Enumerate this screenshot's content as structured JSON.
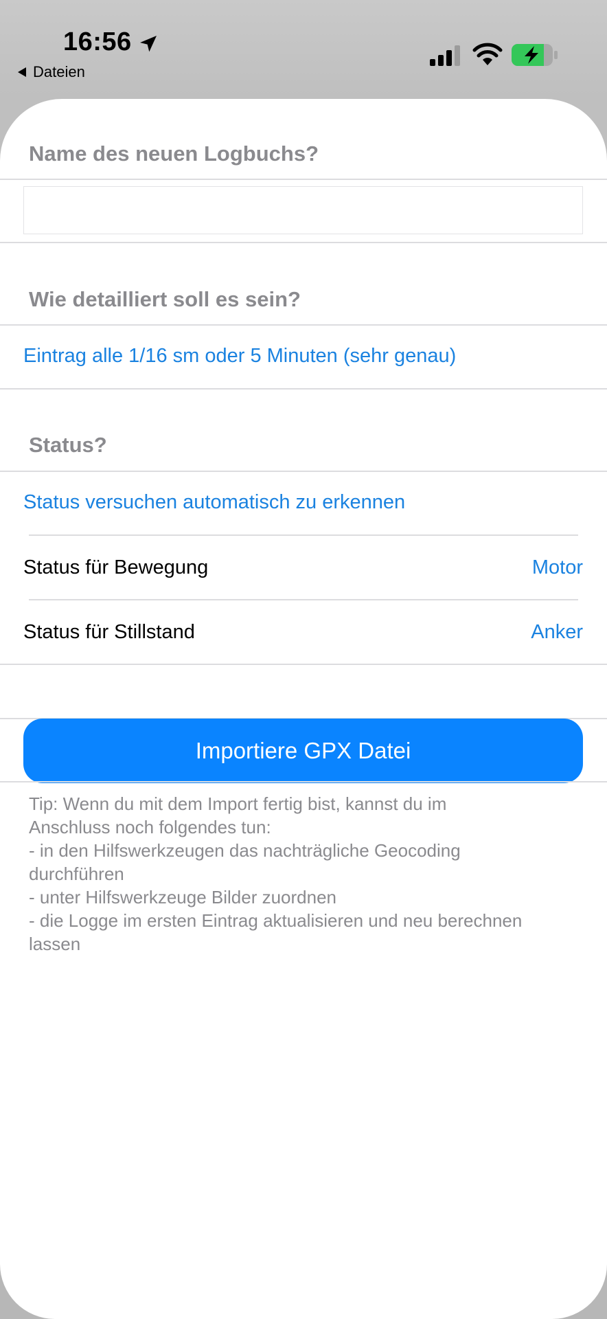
{
  "status_bar": {
    "time": "16:56",
    "back_label": "Dateien",
    "icons": [
      "location-arrow-icon",
      "cellular-signal-icon",
      "wifi-icon",
      "battery-charging-icon"
    ]
  },
  "colors": {
    "accent": "#0a84ff",
    "link_text": "#1a82e0",
    "header_gray": "#8a8a8e",
    "battery_green": "#34c759"
  },
  "form": {
    "name_header": "Name des neuen Logbuchs?",
    "name_value": "",
    "detail_header": "Wie detailliert soll es sein?",
    "detail_option": "Eintrag alle 1/16 sm oder 5 Minuten (sehr genau)",
    "status_header": "Status?",
    "status_auto": "Status versuchen automatisch zu erkennen",
    "status_movement_label": "Status für Bewegung",
    "status_movement_value": "Motor",
    "status_standstill_label": "Status für Stillstand",
    "status_standstill_value": "Anker",
    "import_button": "Importiere GPX Datei"
  },
  "tip": {
    "lines": [
      "Tip: Wenn du mit dem Import fertig bist, kannst du im",
      "Anschluss noch folgendes tun:",
      "- in den Hilfswerkzeugen das nachträgliche Geocoding",
      "durchführen",
      "- unter Hilfswerkzeuge Bilder zuordnen",
      "- die Logge im ersten Eintrag aktualisieren und neu berechnen",
      "lassen"
    ]
  }
}
